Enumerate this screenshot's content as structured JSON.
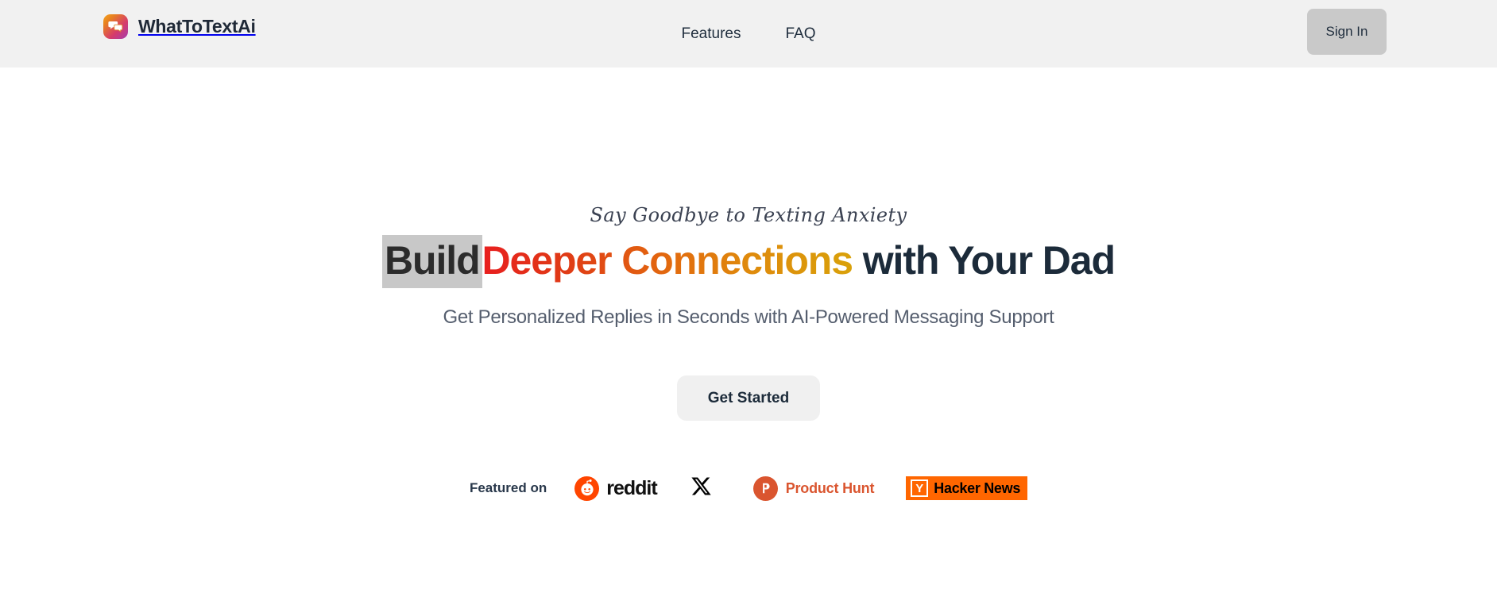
{
  "header": {
    "brand": {
      "name": "WhatToTextAi",
      "logo_icon": "chat-bubbles-icon",
      "gradient_from": "#f5a623",
      "gradient_to": "#a43cb0"
    },
    "nav": [
      {
        "label": "Features"
      },
      {
        "label": "FAQ"
      }
    ],
    "signin_label": "Sign In",
    "background": "#f1f1f1"
  },
  "hero": {
    "eyebrow": "Say Goodbye to Texting Anxiety",
    "title": {
      "highlight_word": "Build",
      "gradient_words": "Deeper Connections",
      "tail_words": "with Your Dad",
      "highlight_bg": "#c8c8c8",
      "gradient_start": "#e81f1f",
      "gradient_end": "#d9a10a",
      "tail_color": "#1c2b3a"
    },
    "subtitle": "Get Personalized Replies in Seconds with AI-Powered Messaging Support",
    "cta_label": "Get Started"
  },
  "featured": {
    "label": "Featured on",
    "items": [
      {
        "name": "reddit",
        "label": "reddit",
        "icon": "reddit-icon",
        "color": "#ff4500"
      },
      {
        "name": "x",
        "label": "",
        "icon": "x-icon",
        "color": "#000000"
      },
      {
        "name": "product-hunt",
        "label": "Product Hunt",
        "icon": "product-hunt-icon",
        "color": "#da552f"
      },
      {
        "name": "hacker-news",
        "label": "Hacker News",
        "icon": "hacker-news-icon",
        "color": "#ff6600",
        "badge": "Y"
      }
    ]
  }
}
